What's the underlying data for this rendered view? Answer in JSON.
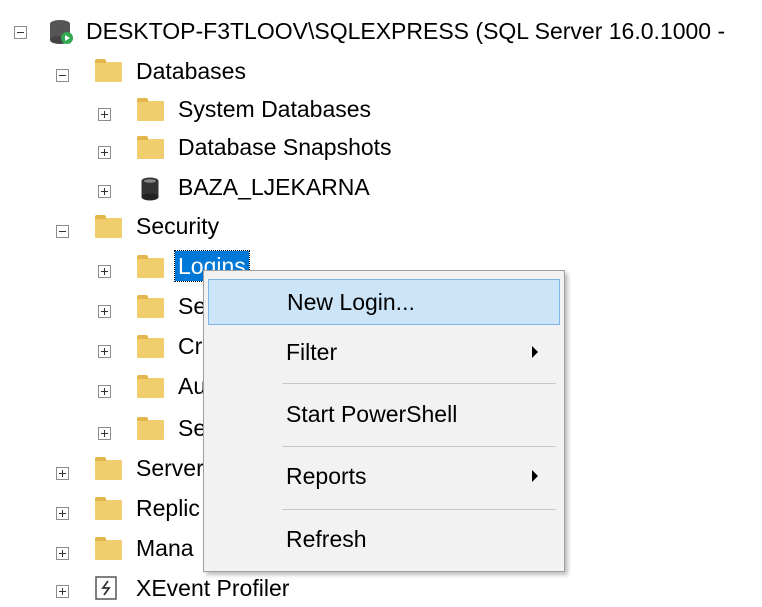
{
  "tree": {
    "server": "DESKTOP-F3TLOOV\\SQLEXPRESS (SQL Server 16.0.1000 -",
    "databases": "Databases",
    "system_databases": "System Databases",
    "database_snapshots": "Database Snapshots",
    "baza": "BAZA_LJEKARNA",
    "security": "Security",
    "logins": "Logins",
    "sec_child_2": "Se",
    "sec_child_3": "Cr",
    "sec_child_4": "Au",
    "sec_child_5": "Se",
    "server_objects": "Server",
    "replication": "Replic",
    "management": "Mana",
    "xevent": "XEvent Profiler"
  },
  "context_menu": {
    "new_login": "New Login...",
    "filter": "Filter",
    "start_powershell": "Start PowerShell",
    "reports": "Reports",
    "refresh": "Refresh"
  },
  "colors": {
    "selection": "#0078d7",
    "menu_highlight": "#cce4f7",
    "folder": "#f0ce6e"
  }
}
